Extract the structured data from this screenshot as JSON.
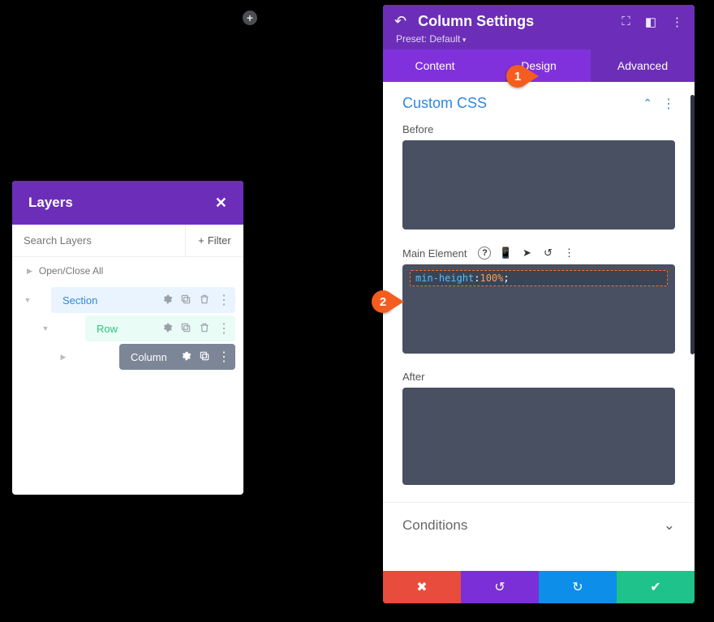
{
  "plus": {
    "label": "+"
  },
  "layers_panel": {
    "title": "Layers",
    "search_placeholder": "Search Layers",
    "filter_label": "Filter",
    "open_close_all": "Open/Close All",
    "rows": {
      "section": "Section",
      "row": "Row",
      "column": "Column"
    }
  },
  "settings_panel": {
    "title": "Column Settings",
    "preset": "Preset: Default",
    "tabs": {
      "content": "Content",
      "design": "Design",
      "advanced": "Advanced"
    },
    "section_title": "Custom CSS",
    "fields": {
      "before_label": "Before",
      "main_label": "Main Element",
      "after_label": "After",
      "main_code": "min-height:100%;",
      "main_code_parts": {
        "prop": "min-height",
        "val": "100%",
        "semi": ";"
      }
    },
    "conditions": "Conditions"
  },
  "callouts": {
    "one": "1",
    "two": "2"
  }
}
